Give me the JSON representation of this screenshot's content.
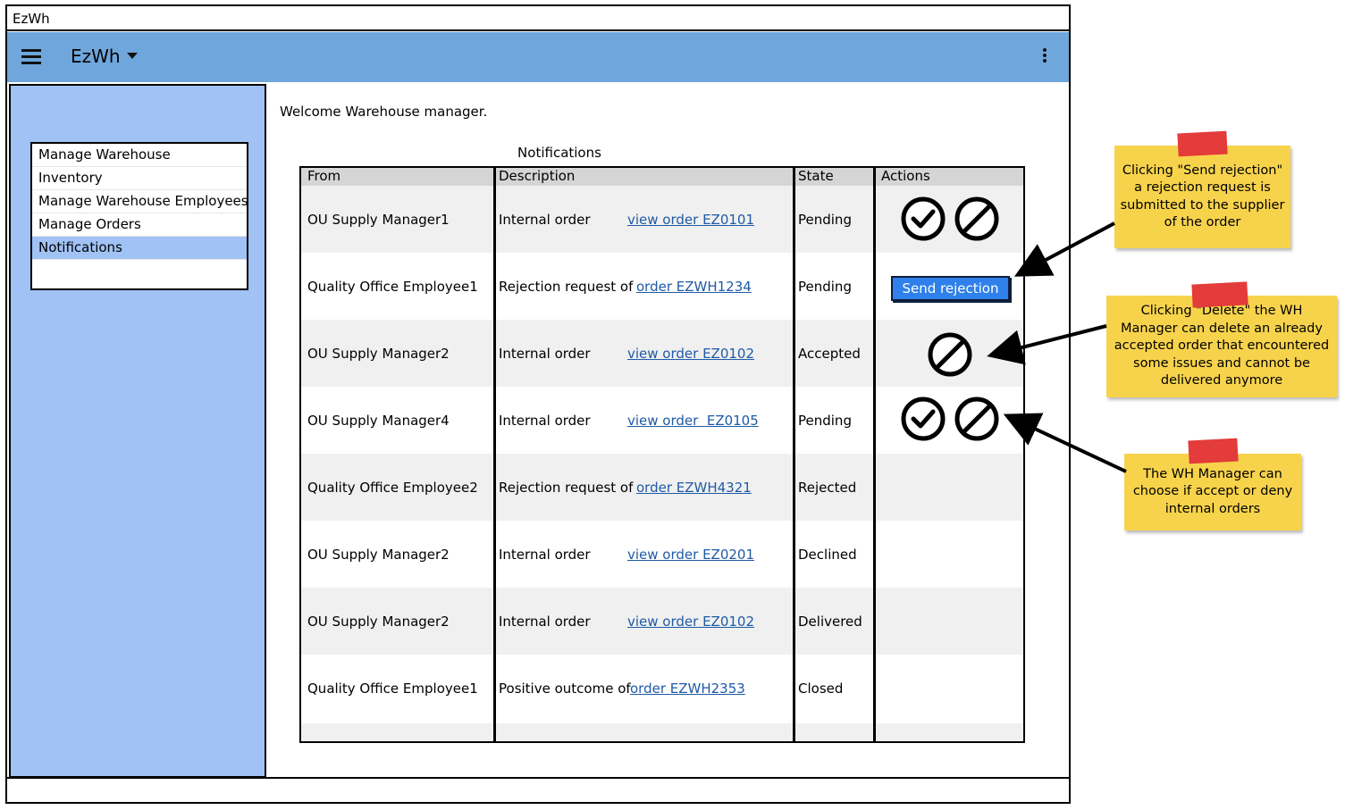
{
  "window": {
    "title": "EzWh"
  },
  "appbar": {
    "title": "EzWh"
  },
  "sidebar": {
    "items": [
      {
        "label": "Manage Warehouse"
      },
      {
        "label": "Inventory"
      },
      {
        "label": "Manage Warehouse Employees"
      },
      {
        "label": "Manage Orders"
      },
      {
        "label": "Notifications",
        "active": true
      }
    ]
  },
  "main": {
    "welcome": "Welcome Warehouse manager.",
    "table_title": "Notifications",
    "columns": [
      "From",
      "Description",
      "State",
      "Actions"
    ],
    "rows": [
      {
        "from": "OU Supply Manager1",
        "desc": "Internal order",
        "link": "view order EZ0101",
        "state": "Pending"
      },
      {
        "from": "Quality Office Employee1",
        "desc": "Rejection request of",
        "link": "order EZWH1234",
        "state": "Pending"
      },
      {
        "from": "OU Supply Manager2",
        "desc": "Internal order",
        "link": "view order EZ0102",
        "state": "Accepted"
      },
      {
        "from": "OU Supply Manager4",
        "desc": "Internal order",
        "link": "view order  EZ0105",
        "state": "Pending"
      },
      {
        "from": "Quality Office Employee2",
        "desc": "Rejection request of",
        "link": "order EZWH4321",
        "state": "Rejected"
      },
      {
        "from": "OU Supply Manager2",
        "desc": "Internal order",
        "link": "view order EZ0201",
        "state": "Declined"
      },
      {
        "from": "OU Supply Manager2",
        "desc": "Internal order",
        "link": "view order EZ0102",
        "state": "Delivered"
      },
      {
        "from": "Quality Office Employee1",
        "desc": "Positive outcome of",
        "link": "order EZWH2353",
        "state": "Closed"
      }
    ],
    "send_rejection_label": "Send rejection"
  },
  "notes": [
    {
      "text": "Clicking \"Send rejection\" a rejection request is submitted to the supplier of the order"
    },
    {
      "text": "Clicking \"Delete\" the WH Manager can delete an already accepted order that encountered some issues and cannot be delivered anymore"
    },
    {
      "text": "The WH Manager can choose if accept or deny internal orders"
    }
  ],
  "icons": {
    "accept": "check-circle-icon",
    "deny": "deny-circle-icon",
    "menu": "hamburger-icon",
    "dropdown": "caret-down-icon",
    "more": "kebab-icon"
  },
  "colors": {
    "appbar": "#6fa7dc",
    "sidebar": "#a0c2f5",
    "link": "#1f5aa6",
    "button": "#2f80ea",
    "note": "#f7d34c",
    "tape": "#e43b3b"
  }
}
